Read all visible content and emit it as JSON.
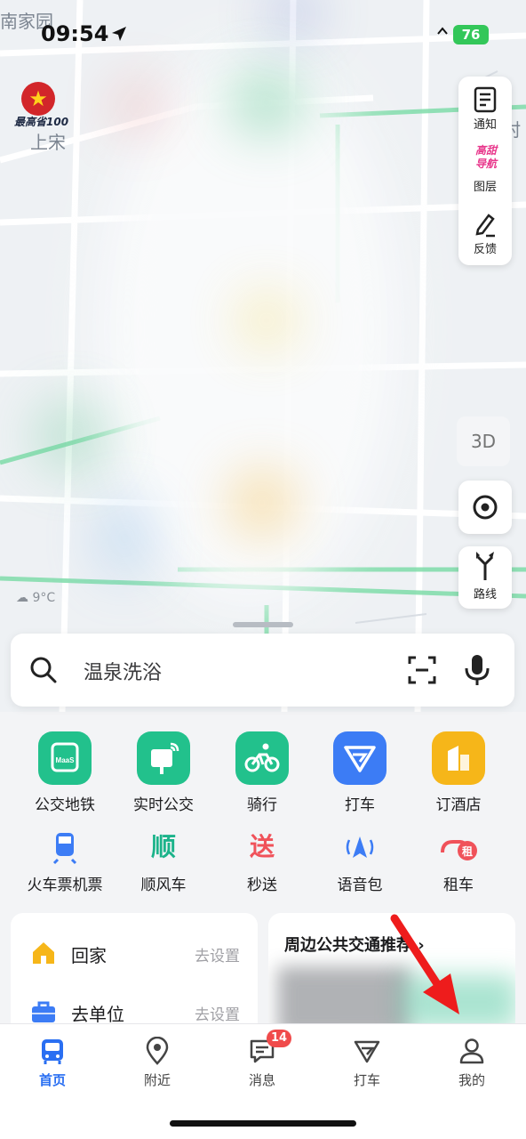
{
  "status_bar": {
    "time": "09:54",
    "battery": "76"
  },
  "map": {
    "labels": [
      "南家园",
      "上宋",
      "村",
      "3D"
    ],
    "promo_tag": "最高省100",
    "weather": "9°C"
  },
  "map_tools": [
    {
      "label": "通知",
      "icon": "notification-icon"
    },
    {
      "label": "图层",
      "icon_text": "高甜\n导航",
      "icon": "layers-icon"
    },
    {
      "label": "反馈",
      "icon": "feedback-pencil-icon"
    }
  ],
  "route_button": {
    "label": "路线"
  },
  "search": {
    "placeholder": "温泉洗浴"
  },
  "quick_actions": [
    {
      "label": "公交地铁",
      "icon": "bus-maas-icon",
      "color": "#22c18c"
    },
    {
      "label": "实时公交",
      "icon": "realtime-bus-icon",
      "color": "#22c18c"
    },
    {
      "label": "骑行",
      "icon": "cycling-icon",
      "color": "#22c18c"
    },
    {
      "label": "打车",
      "icon": "taxi-icon",
      "color": "#3c7cf5"
    },
    {
      "label": "订酒店",
      "icon": "hotel-icon",
      "color": "#f6b619"
    }
  ],
  "secondary_actions": [
    {
      "label": "火车票机票",
      "icon": "train-icon",
      "glyph": ""
    },
    {
      "label": "顺风车",
      "icon": "carpool-icon",
      "glyph": "顺"
    },
    {
      "label": "秒送",
      "icon": "delivery-icon",
      "glyph": "送"
    },
    {
      "label": "语音包",
      "icon": "voice-pack-icon",
      "glyph": ""
    },
    {
      "label": "租车",
      "icon": "car-rental-icon",
      "glyph": "租"
    }
  ],
  "shortcuts": [
    {
      "label": "回家",
      "action": "去设置",
      "icon": "home-icon"
    },
    {
      "label": "去单位",
      "action": "去设置",
      "icon": "briefcase-icon"
    }
  ],
  "transit_card": {
    "title": "周边公共交通推荐"
  },
  "tabs": [
    {
      "label": "首页",
      "icon": "bus-home-icon",
      "active": true
    },
    {
      "label": "附近",
      "icon": "location-pin-icon",
      "active": false
    },
    {
      "label": "消息",
      "icon": "message-icon",
      "active": false,
      "badge": "14"
    },
    {
      "label": "打车",
      "icon": "taxi-tab-icon",
      "active": false
    },
    {
      "label": "我的",
      "icon": "profile-icon",
      "active": false
    }
  ],
  "colors": {
    "accent": "#2a6ff2",
    "green": "#22c18c",
    "red_badge": "#f04b4b"
  }
}
